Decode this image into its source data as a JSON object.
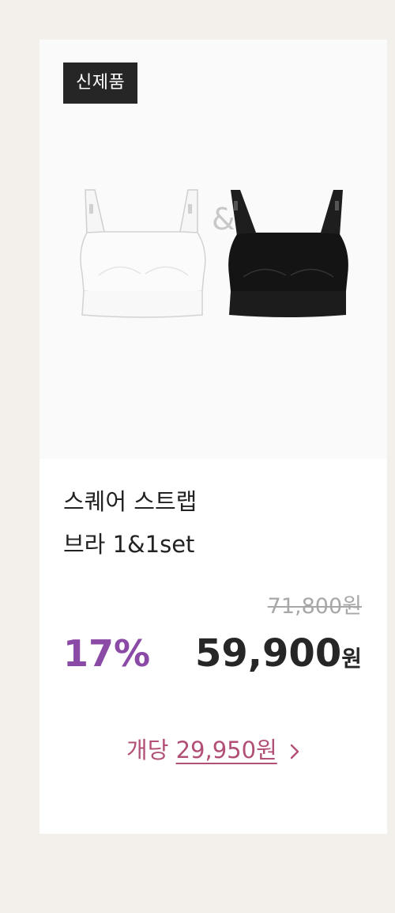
{
  "badge": {
    "label": "신제품"
  },
  "product": {
    "title_line1": "스퀘어 스트랩",
    "title_line2": "브라 1&1set",
    "image_separator": "&"
  },
  "price": {
    "original": "71,800원",
    "discount_percent": "17%",
    "sale_number": "59,900",
    "sale_unit": "원"
  },
  "per_unit": {
    "prefix": "개당",
    "amount": "29,950원",
    "icon": "chevron-right-icon"
  },
  "colors": {
    "discount": "#8a4aa6",
    "per_unit": "#b14f76",
    "badge_bg": "#262626",
    "page_bg": "#f3f0eb"
  }
}
